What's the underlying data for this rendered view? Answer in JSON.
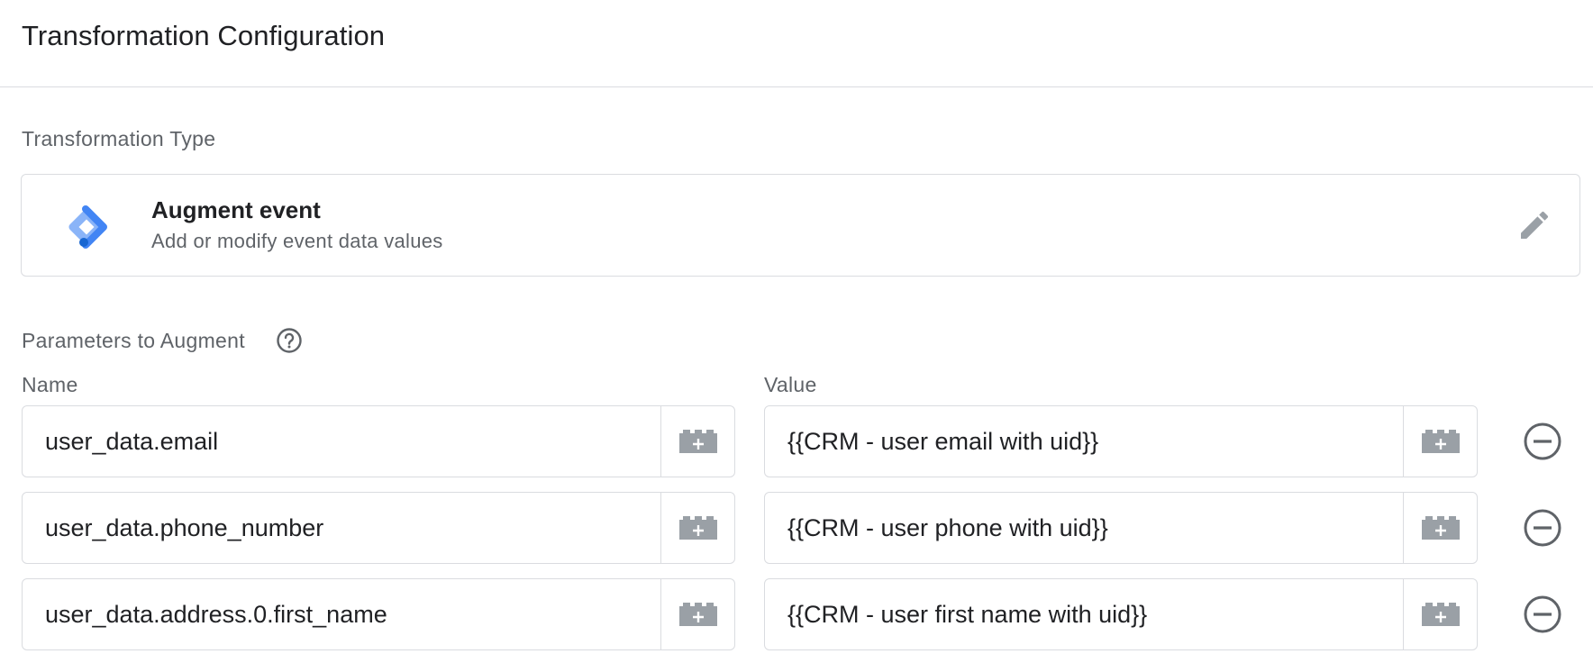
{
  "header": {
    "title": "Transformation Configuration"
  },
  "transformation_type": {
    "label": "Transformation Type",
    "title": "Augment event",
    "description": "Add or modify event data values",
    "icon": "tag-manager-icon",
    "edit_icon": "pencil-icon"
  },
  "parameters": {
    "label": "Parameters to Augment",
    "help_icon": "help-circle-icon",
    "name_header": "Name",
    "value_header": "Value",
    "rows": [
      {
        "name": "user_data.email",
        "value": "{{CRM - user email with uid}}"
      },
      {
        "name": "user_data.phone_number",
        "value": "{{CRM - user phone with uid}}"
      },
      {
        "name": "user_data.address.0.first_name",
        "value": "{{CRM - user first name with uid}}"
      }
    ]
  },
  "colors": {
    "accent_blue": "#4285f4",
    "accent_light_blue": "#8ab4f8",
    "accent_dark_blue": "#1967d2",
    "icon_gray": "#8a8c8f",
    "border": "#dadce0"
  }
}
